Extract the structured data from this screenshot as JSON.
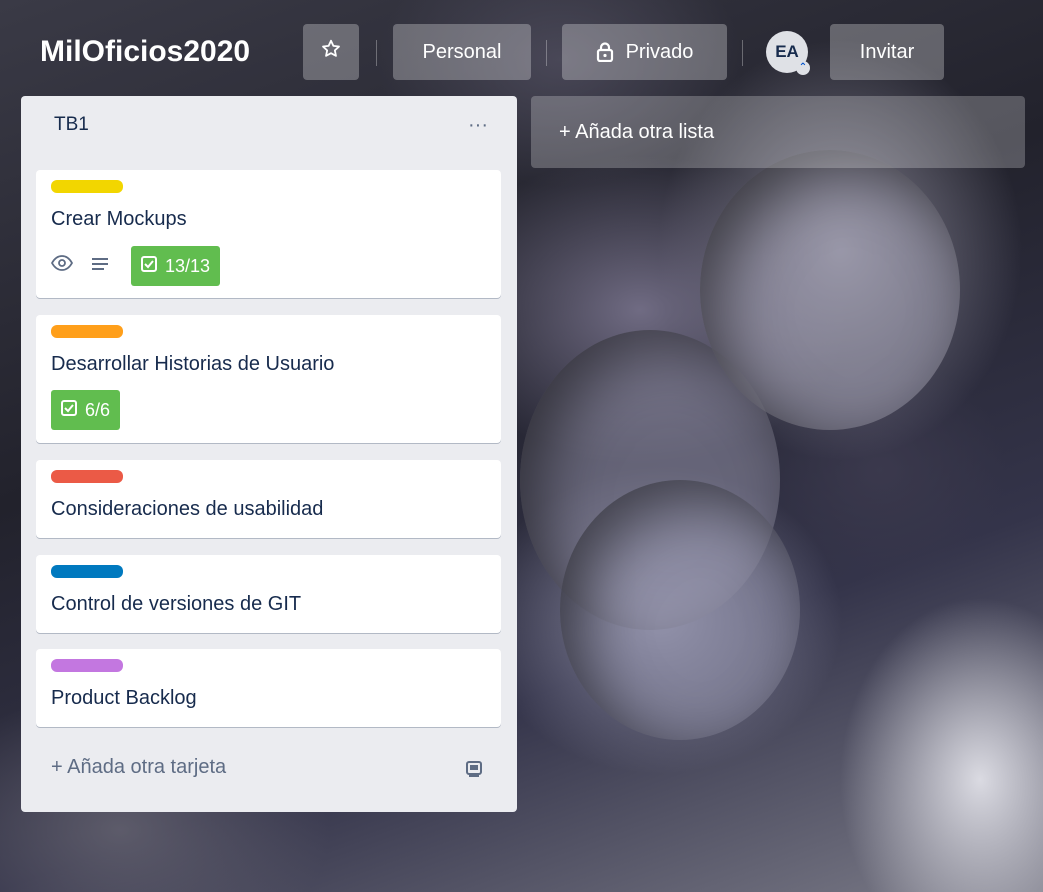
{
  "board": {
    "title": "MilOficios2020",
    "star_icon": "star-icon",
    "visibility_team": "Personal",
    "privacy_label": "Privado",
    "privacy_icon": "lock-icon",
    "member_initials": "EA",
    "invite_label": "Invitar"
  },
  "list": {
    "title": "TB1",
    "menu_glyph": "···",
    "add_card_label": "+ Añada otra tarjeta",
    "cards": [
      {
        "title": "Crear Mockups",
        "label_color": "#f2d600",
        "checklist": "13/13",
        "has_watch": true,
        "has_description": true
      },
      {
        "title": "Desarrollar Historias de Usuario",
        "label_color": "#ff9f1a",
        "checklist": "6/6"
      },
      {
        "title": "Consideraciones de usabilidad",
        "label_color": "#eb5a46"
      },
      {
        "title": "Control de versiones de GIT",
        "label_color": "#0079bf"
      },
      {
        "title": "Product Backlog",
        "label_color": "#c377e0"
      }
    ]
  },
  "add_list_label": "+ Añada otra lista",
  "colors": {
    "checklist_complete": "#61bd4f",
    "list_background": "#ebecf0"
  }
}
